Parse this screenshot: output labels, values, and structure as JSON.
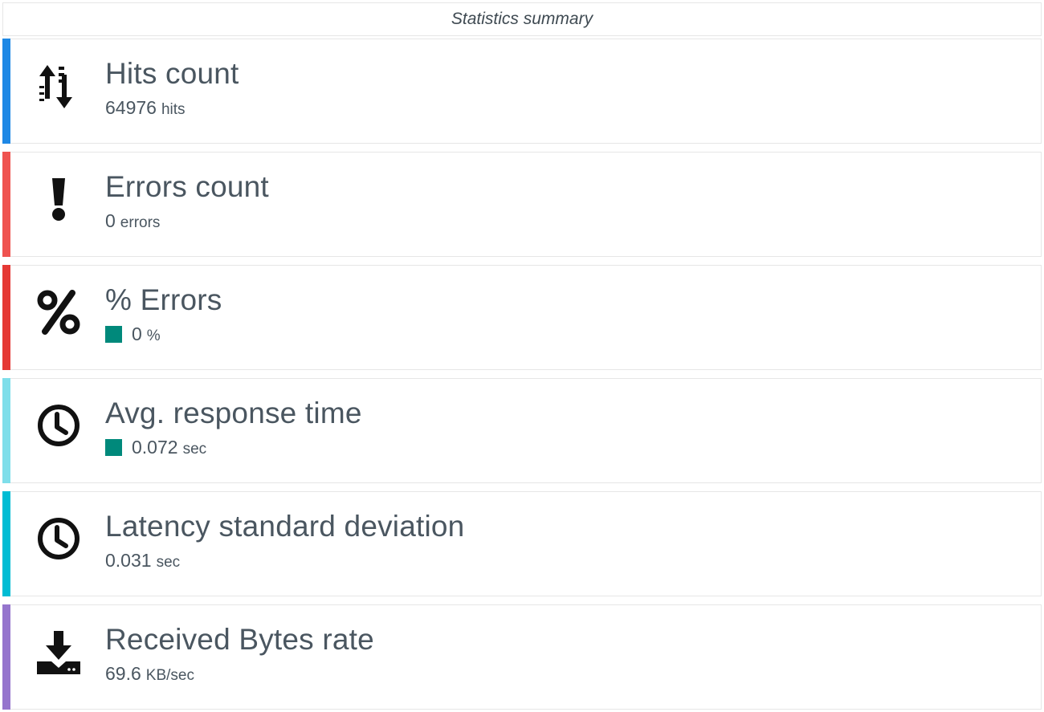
{
  "header": {
    "title": "Statistics summary"
  },
  "colors": {
    "hits_accent": "#1e88e5",
    "errors_accent": "#ef5350",
    "pct_errors_accent": "#e53935",
    "avg_response_accent": "#7fdeea",
    "latency_accent": "#00bcd4",
    "received_accent": "#9575cd",
    "status_swatch": "#00897b"
  },
  "cards": [
    {
      "icon": "sort-arrows-icon",
      "label": "Hits count",
      "value": "64976",
      "unit": "hits"
    },
    {
      "icon": "exclamation-icon",
      "label": "Errors count",
      "value": "0",
      "unit": "errors"
    },
    {
      "icon": "percent-icon",
      "label": "% Errors",
      "value": "0",
      "unit": "%"
    },
    {
      "icon": "clock-icon",
      "label": "Avg. response time",
      "value": "0.072",
      "unit": "sec"
    },
    {
      "icon": "clock-icon",
      "label": "Latency standard deviation",
      "value": "0.031",
      "unit": "sec"
    },
    {
      "icon": "download-icon",
      "label": "Received Bytes rate",
      "value": "69.6",
      "unit": "KB/sec"
    }
  ]
}
